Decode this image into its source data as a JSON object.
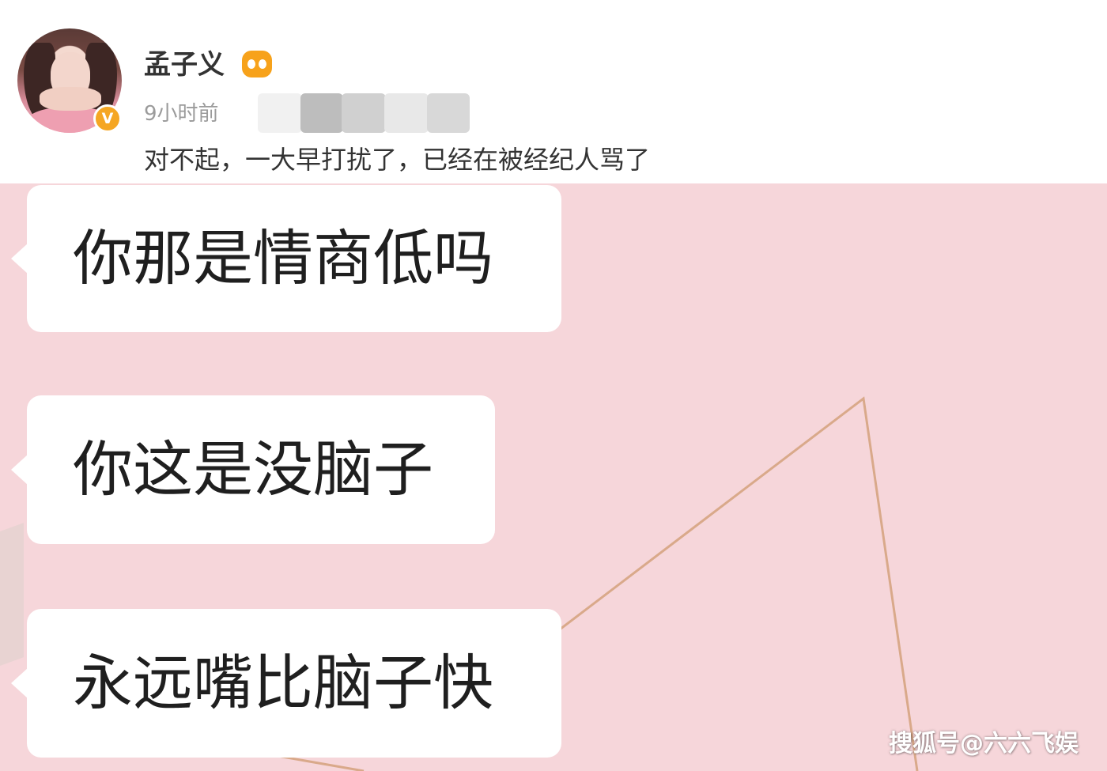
{
  "post": {
    "username": "孟子义",
    "verified_mark": "V",
    "time": "9小时前",
    "text": "对不起，一大早打扰了，已经在被经纪人骂了"
  },
  "chat": {
    "messages": [
      "你那是情商低吗",
      "你这是没脑子",
      "永远嘴比脑子快"
    ]
  },
  "watermark": "搜狐号@六六飞娱",
  "colors": {
    "chat_background": "#f6d6da",
    "bubble": "#ffffff",
    "verified_badge": "#f5a623",
    "member_icon": "#f7a21b"
  },
  "icons": {
    "verified": "verified-v-badge-icon",
    "member": "member-crown-icon"
  }
}
